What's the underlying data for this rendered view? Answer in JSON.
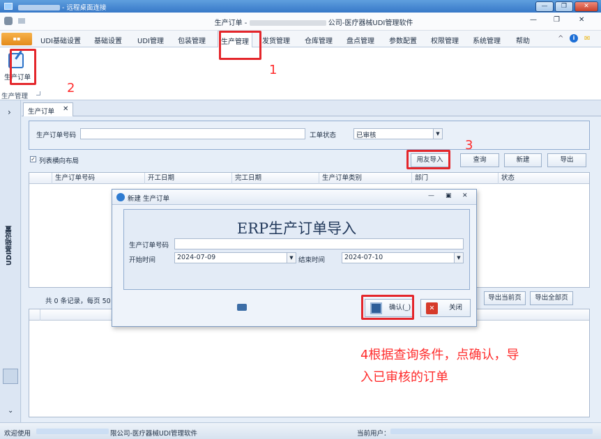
{
  "remote_bar": {
    "title": "- 远程桌面连接"
  },
  "window_controls": {
    "minimize": "—",
    "restore": "❐",
    "close": "✕"
  },
  "app": {
    "title_prefix": "生产订单 -",
    "title_suffix": "公司-医疗器械UDI管理软件",
    "minimize": "—",
    "restore": "❐",
    "close": "✕"
  },
  "menu": {
    "app_button": "▪▪",
    "items": [
      "UDI基础设置",
      "基础设置",
      "UDI管理",
      "包装管理",
      "生产管理",
      "发货管理",
      "仓库管理",
      "盘点管理",
      "参数配置",
      "权限管理",
      "系统管理",
      "帮助"
    ],
    "active": "生产管理",
    "right_icons": [
      "^",
      "i",
      "✉"
    ]
  },
  "ribbon": {
    "button_label": "生产订单",
    "group_label": "生产管理"
  },
  "sidebar": {
    "expand": "›",
    "vertical_label": "UDI基础设置",
    "scroll_down": "⌄"
  },
  "tab": {
    "label": "生产订单",
    "close": "✕"
  },
  "filter": {
    "order_no_label": "生产订单号码",
    "order_no_value": "",
    "status_label": "工单状态",
    "status_value": "已审核"
  },
  "layout_checkbox": {
    "label": "列表横向布局",
    "checked": "✓"
  },
  "toolbar": {
    "import_label": "用友导入",
    "query_label": "查询",
    "new_label": "新建",
    "export_label": "导出"
  },
  "table": {
    "columns": [
      "生产订单号码",
      "开工日期",
      "完工日期",
      "生产订单类别",
      "部门",
      "状态"
    ]
  },
  "pager": {
    "summary": "共 0 条记录，每页 50",
    "export_page": "导出当前页",
    "export_all": "导出全部页"
  },
  "dialog": {
    "title": "新建 生产订单",
    "controls": [
      "—",
      "▣",
      "✕"
    ],
    "heading": "ERP生产订单导入",
    "order_no_label": "生产订单号码",
    "order_no_value": "",
    "start_label": "开始时间",
    "start_value": "2024-07-09",
    "end_label": "结束时间",
    "end_value": "2024-07-10",
    "confirm_label": "确认(_)",
    "close_label": "关闭"
  },
  "annotations": {
    "n1": "1",
    "n2": "2",
    "n3": "3",
    "n4_line1": "4根据查询条件，点确认，导",
    "n4_line2": "入已审核的订单"
  },
  "status_bar": {
    "welcome": "欢迎使用",
    "company": "限公司-医疗器械UDI管理软件",
    "current_user": "当前用户："
  },
  "colors": {
    "accent": "#3778c8",
    "annotation": "#e4262b",
    "ribbon_border": "#b9c9dd"
  }
}
